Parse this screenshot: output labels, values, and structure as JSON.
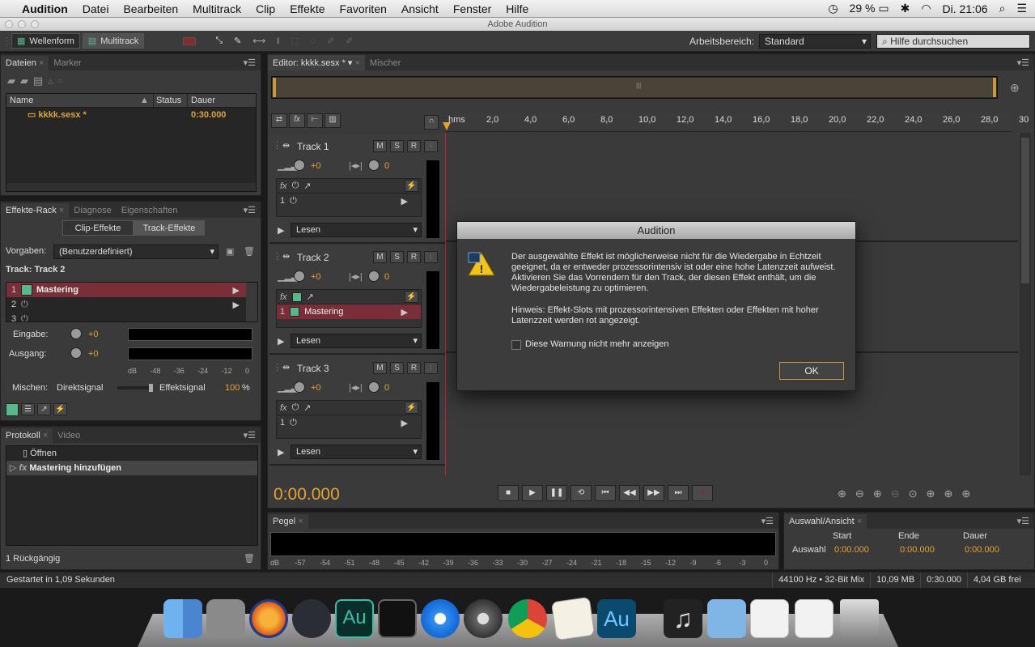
{
  "menubar": {
    "apple": "",
    "app": "Audition",
    "items": [
      "Datei",
      "Bearbeiten",
      "Multitrack",
      "Clip",
      "Effekte",
      "Favoriten",
      "Ansicht",
      "Fenster",
      "Hilfe"
    ],
    "battery": "29 %",
    "clock": "Di. 21:06"
  },
  "window": {
    "title": "Adobe Audition"
  },
  "toolbar": {
    "waveform": "Wellenform",
    "multitrack": "Multitrack",
    "workspace_label": "Arbeitsbereich:",
    "workspace_value": "Standard",
    "help_placeholder": "Hilfe durchsuchen"
  },
  "files_panel": {
    "tabs": [
      "Dateien",
      "Marker"
    ],
    "columns": [
      "Name",
      "Status",
      "Dauer"
    ],
    "rows": [
      {
        "name": "kkkk.sesx *",
        "duration": "0:30.000"
      }
    ]
  },
  "effects_panel": {
    "tabs": [
      "Effekte-Rack",
      "Diagnose",
      "Eigenschaften"
    ],
    "clip_btn": "Clip-Effekte",
    "track_btn": "Track-Effekte",
    "presets_label": "Vorgaben:",
    "presets_value": "(Benutzerdefiniert)",
    "track_label": "Track: Track 2",
    "slots": [
      {
        "num": "1",
        "name": "Mastering"
      },
      {
        "num": "2",
        "name": ""
      },
      {
        "num": "3",
        "name": ""
      }
    ],
    "input_label": "Eingabe:",
    "input_value": "+0",
    "output_label": "Ausgang:",
    "output_value": "+0",
    "meter_scale": [
      "dB",
      "-48",
      "-36",
      "-24",
      "-12",
      "0"
    ],
    "mix_label": "Mischen:",
    "dry_label": "Direktsignal",
    "wet_label": "Effektsignal",
    "wet_value": "100",
    "wet_unit": "%"
  },
  "history_panel": {
    "tabs": [
      "Protokoll",
      "Video"
    ],
    "items": [
      "Öffnen",
      "Mastering hinzufügen"
    ],
    "undo_count": "1 Rückgängig"
  },
  "editor": {
    "tab": "Editor: kkkk.sesx *",
    "mixer_tab": "Mischer",
    "ruler": [
      "hms",
      "2,0",
      "4,0",
      "6,0",
      "8,0",
      "10,0",
      "12,0",
      "14,0",
      "16,0",
      "18,0",
      "20,0",
      "22,0",
      "24,0",
      "26,0",
      "28,0",
      "30"
    ],
    "time": "0:00.000",
    "tracks": [
      {
        "name": "Track 1",
        "vol": "+0",
        "pan": "0",
        "slot1": "",
        "mode": "Lesen"
      },
      {
        "name": "Track 2",
        "vol": "+0",
        "pan": "0",
        "slot1": "Mastering",
        "mode": "Lesen"
      },
      {
        "name": "Track 3",
        "vol": "+0",
        "pan": "0",
        "slot1": "",
        "mode": "Lesen"
      }
    ],
    "msr": [
      "M",
      "S",
      "R",
      "I"
    ]
  },
  "levels_panel": {
    "tab": "Pegel",
    "scale": [
      "dB",
      "-57",
      "-54",
      "-51",
      "-48",
      "-45",
      "-42",
      "-39",
      "-36",
      "-33",
      "-30",
      "-27",
      "-24",
      "-21",
      "-18",
      "-15",
      "-12",
      "-9",
      "-6",
      "-3",
      "0"
    ]
  },
  "selection_panel": {
    "tab": "Auswahl/Ansicht",
    "cols": [
      "Start",
      "Ende",
      "Dauer"
    ],
    "row_label": "Auswahl",
    "values": [
      "0:00.000",
      "0:00.000",
      "0:00.000"
    ]
  },
  "statusbar": {
    "left": "Gestartet in 1,09 Sekunden",
    "format": "44100 Hz • 32-Bit Mix",
    "size": "10,09 MB",
    "duration": "0:30.000",
    "free": "4,04 GB frei"
  },
  "dialog": {
    "title": "Audition",
    "message": "Der ausgewählte Effekt ist möglicherweise nicht für die Wiedergabe in Echtzeit geeignet, da er entweder prozessorintensiv ist oder eine hohe Latenzzeit aufweist. Aktivieren Sie das Vorrendern für den Track, der diesen Effekt enthält, um die Wiedergabeleistung zu optimieren.",
    "hint": "Hinweis: Effekt-Slots mit prozessorintensiven Effekten oder Effekten mit hoher Latenzzeit werden rot angezeigt.",
    "checkbox": "Diese Warnung nicht mehr anzeigen",
    "ok": "OK"
  },
  "dock": {
    "icons": [
      "finder-icon",
      "system-preferences-icon",
      "firefox-icon",
      "steam-icon",
      "audition-icon",
      "activity-monitor-icon",
      "itunes-icon",
      "disk-utility-icon",
      "chrome-icon",
      "textedit-icon",
      "audition-installer-icon",
      "itunes-alt-icon",
      "downloads-folder-icon",
      "document-stack-icon",
      "chrome-document-icon",
      "trash-icon"
    ]
  }
}
